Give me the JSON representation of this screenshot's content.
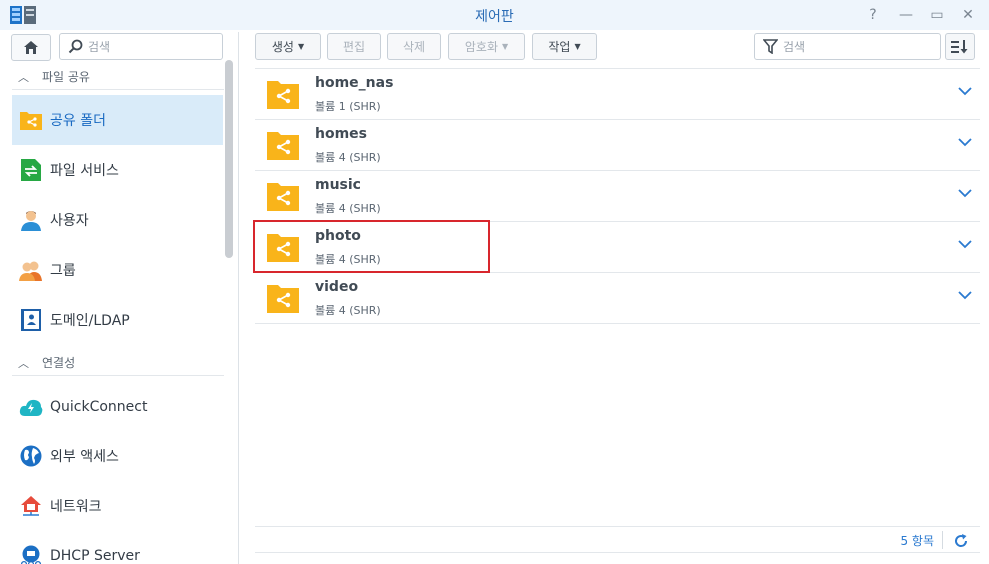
{
  "window": {
    "title": "제어판",
    "help_glyph": "?",
    "minimize_glyph": "—",
    "maximize_glyph": "▭",
    "close_glyph": "✕"
  },
  "sidebar": {
    "search_placeholder": "검색",
    "sections": [
      {
        "label": "파일 공유"
      },
      {
        "label": "연결성"
      }
    ],
    "items": [
      {
        "label": "공유 폴더",
        "icon": "shared-folder-icon",
        "active": true
      },
      {
        "label": "파일 서비스",
        "icon": "file-services-icon"
      },
      {
        "label": "사용자",
        "icon": "user-icon"
      },
      {
        "label": "그룹",
        "icon": "group-icon"
      },
      {
        "label": "도메인/LDAP",
        "icon": "domain-ldap-icon"
      },
      {
        "label": "QuickConnect",
        "icon": "quickconnect-icon"
      },
      {
        "label": "외부 액세스",
        "icon": "globe-icon"
      },
      {
        "label": "네트워크",
        "icon": "network-home-icon"
      },
      {
        "label": "DHCP Server",
        "icon": "dhcp-server-icon"
      }
    ]
  },
  "toolbar": {
    "create": "생성",
    "edit": "편집",
    "delete": "삭제",
    "encrypt": "암호화",
    "action": "작업",
    "filter_placeholder": "검색"
  },
  "folders": [
    {
      "name": "home_nas",
      "volume": "볼륨 1 (SHR)"
    },
    {
      "name": "homes",
      "volume": "볼륨 4 (SHR)"
    },
    {
      "name": "music",
      "volume": "볼륨 4 (SHR)"
    },
    {
      "name": "photo",
      "volume": "볼륨 4 (SHR)"
    },
    {
      "name": "video",
      "volume": "볼륨 4 (SHR)"
    }
  ],
  "footer": {
    "count": "5 항목"
  },
  "colors": {
    "accent": "#2b7ad0",
    "folder": "#f9b41a",
    "active_bg": "#d9ebf9",
    "highlight": "#d8262d"
  }
}
